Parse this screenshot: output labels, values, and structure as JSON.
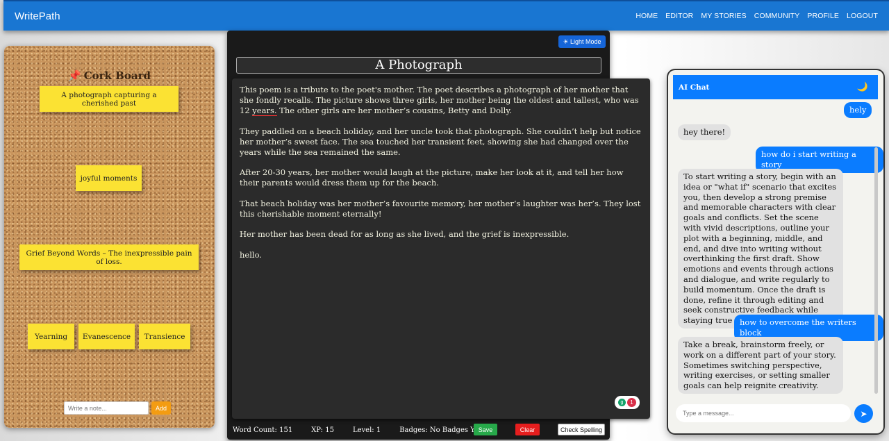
{
  "navbar": {
    "brand": "WritePath",
    "links": [
      "HOME",
      "EDITOR",
      "MY STORIES",
      "COMMUNITY",
      "PROFILE",
      "LOGOUT"
    ]
  },
  "corkboard": {
    "title": "Cork Board",
    "pin_icon": "pushpin-icon",
    "notes": [
      "A photograph capturing a cherished past",
      "joyful moments",
      "Grief Beyond Words – The inexpressible pain of loss.",
      "Yearning",
      "Evanescence",
      "Transience"
    ],
    "note_placeholder": "Write a note...",
    "add_label": "Add"
  },
  "editor": {
    "mode_button": "☀ Light Mode",
    "title": "A Photograph",
    "paragraphs": [
      {
        "before": "This poem is a tribute to the poet's mother. The poet describes a photograph of her mother that she fondly recalls. The picture shows three girls, her mother being the oldest and tallest, who was 12 ",
        "flagged": "years.",
        "after": " The other girls are her mother’s cousins, Betty and Dolly."
      },
      {
        "text": "They paddled on a beach holiday, and her uncle took that photograph. She couldn’t help but notice her mother’s sweet face. The sea touched her transient feet, showing she had changed over the years while the sea remained the same."
      },
      {
        "text": "After 20-30 years, her mother would laugh at the picture, make her look at it, and tell her how their parents would dress them up for the beach."
      },
      {
        "text": "That beach holiday was her mother’s favourite memory, her mother’s laughter was her’s. They lost this cherishable moment eternally!"
      },
      {
        "text": "Her mother has been dead for as long as she lived, and the grief is inexpressible."
      },
      {
        "text": "hello."
      }
    ],
    "grammar_count": "1",
    "word_count": "Word Count: 151",
    "xp": "XP: 15",
    "level": "Level: 1",
    "badges": "Badges: No Badges Yet",
    "save_label": "Save",
    "clear_label": "Clear",
    "spell_label": "Check Spelling"
  },
  "chat": {
    "title": "AI Chat",
    "theme_icon": "moon-icon",
    "messages": [
      {
        "role": "user",
        "text": "hely"
      },
      {
        "role": "bot",
        "text": "hey there!"
      },
      {
        "role": "user",
        "text": "how do i start writing a story"
      },
      {
        "role": "bot",
        "text": "To start writing a story, begin with an idea or \"what if\" scenario that excites you, then develop a strong premise and memorable characters with clear goals and conflicts. Set the scene with vivid descriptions, outline your plot with a beginning, middle, and end, and dive into writing without overthinking the first draft. Show emotions and events through actions and dialogue, and write regularly to build momentum. Once the draft is done, refine it through editing and seek constructive feedback while staying true to your vision."
      },
      {
        "role": "user",
        "text": "how to overcome the writers block"
      },
      {
        "role": "bot",
        "text": "Take a break, brainstorm freely, or work on a different part of your story. Sometimes switching perspective, writing exercises, or setting smaller goals can help reignite creativity."
      }
    ],
    "input_placeholder": "Type a message...",
    "send_icon": "send-icon"
  }
}
